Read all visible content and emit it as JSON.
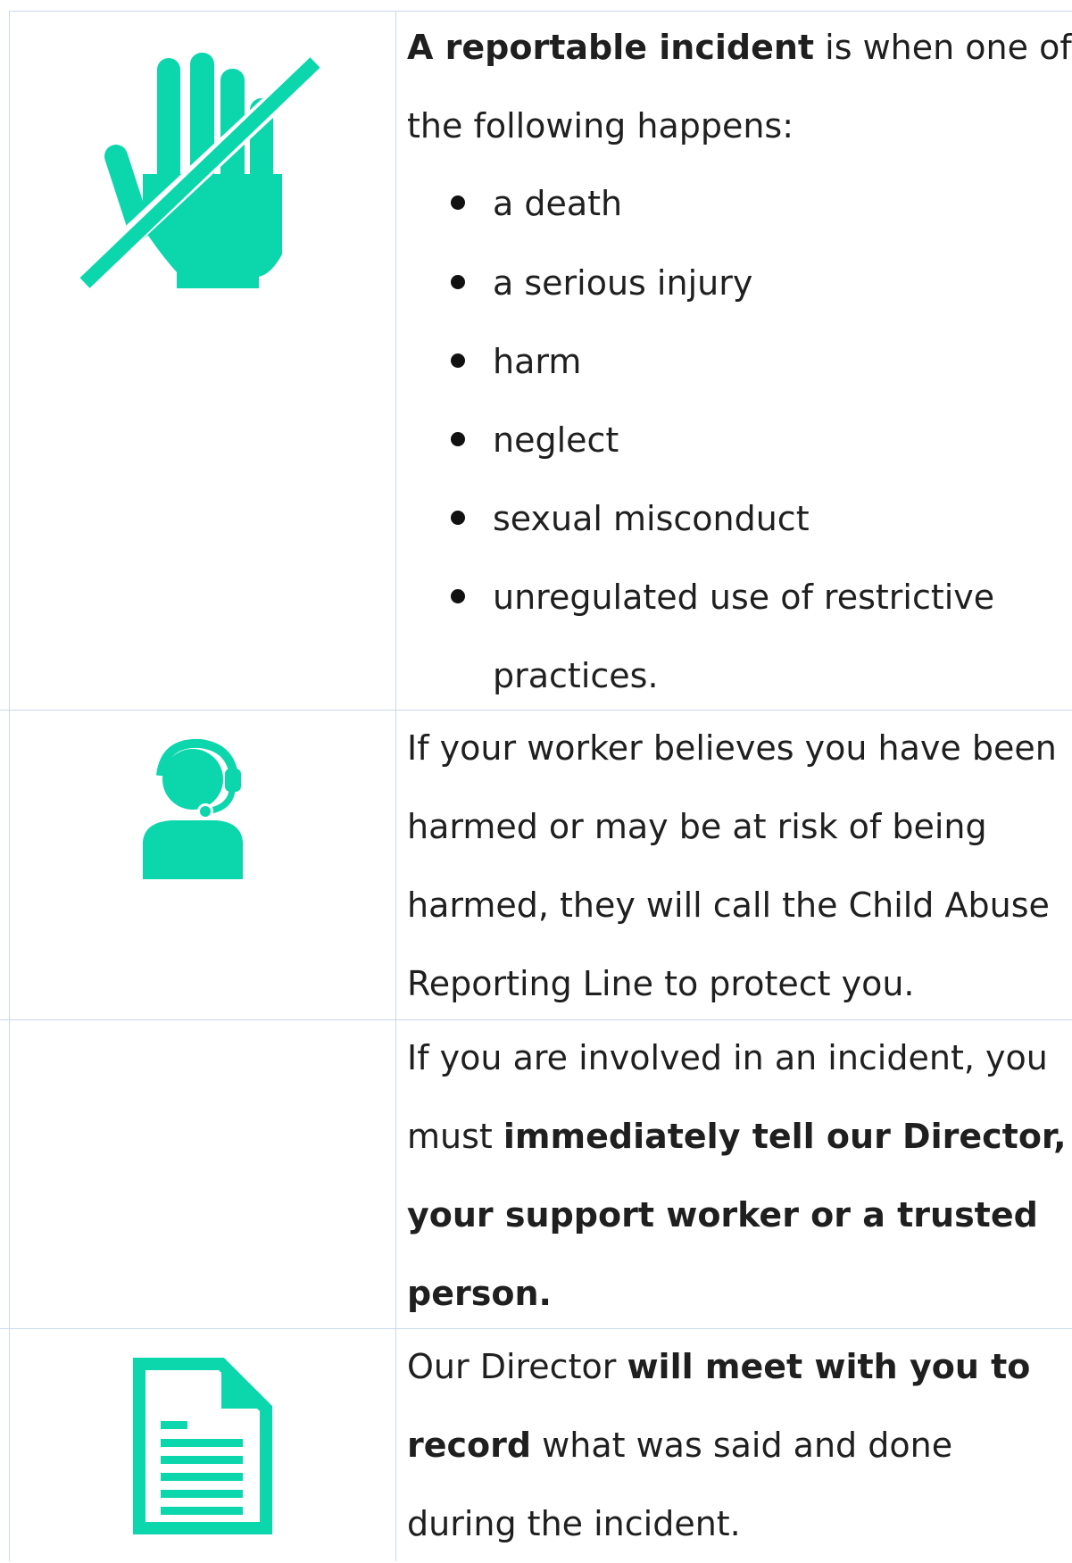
{
  "accent_color": "#0bd6ac",
  "rows": [
    {
      "icon": "no-hand-icon",
      "lead_bold": "A reportable incident",
      "lead_rest": " is when one of",
      "line2": "the following happens:",
      "bullets": [
        "a death",
        "a serious injury",
        "harm",
        "neglect",
        "sexual misconduct",
        "unregulated use of restrictive"
      ],
      "bullet_continuation": "practices."
    },
    {
      "icon": "headset-person-icon",
      "lines": [
        "If your worker believes you have been",
        "harmed or may be at risk of being",
        "harmed, they will call the Child Abuse",
        "Reporting Line to protect you."
      ]
    },
    {
      "line1": "If you are involved in an incident, you",
      "line2_plain": "must ",
      "line2_bold": "immediately tell our Director,",
      "line3_bold": "your support worker or a trusted",
      "line4_bold": "person."
    },
    {
      "icon": "document-icon",
      "line1_plain": "Our Director ",
      "line1_bold": "will meet with you to",
      "line2_bold": "record",
      "line2_rest": " what was said and done",
      "line3": "during the incident."
    }
  ]
}
